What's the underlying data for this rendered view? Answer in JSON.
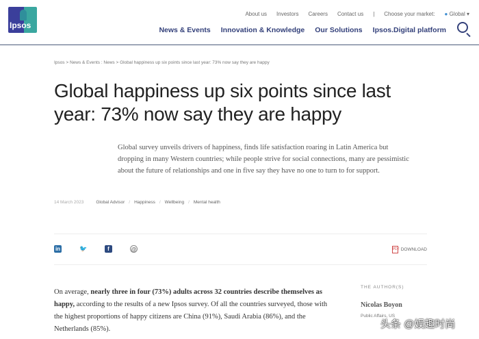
{
  "header": {
    "logo_text": "Ipsos",
    "utility": [
      "About us",
      "Investors",
      "Careers",
      "Contact us",
      "|",
      "Choose your market:"
    ],
    "market": "Global ▾",
    "nav": [
      "News & Events",
      "Innovation & Knowledge",
      "Our Solutions",
      "Ipsos.Digital platform"
    ]
  },
  "breadcrumb": "Ipsos  > News & Events : News  > Global happiness up six points since last year: 73% now say they are happy",
  "title": "Global happiness up six points since last year: 73% now say they are happy",
  "lede": "Global survey unveils drivers of happiness, finds life satisfaction roaring in Latin America but dropping in many Western countries; while people strive for social connections, many are pessimistic about the future of relationships and one in five say they have no one to turn to for support.",
  "meta": {
    "date": "14 March 2023",
    "tags": [
      "Global Advisor",
      "Happiness",
      "Wellbeing",
      "Mental health"
    ]
  },
  "share": {
    "linkedin": "in",
    "twitter": "🐦",
    "facebook": "f",
    "email": "@",
    "download": "DOWNLOAD"
  },
  "body": {
    "p1_a": "On average, ",
    "p1_b": "nearly three in four (73%) adults across 32 countries describe themselves as happy,",
    "p1_c": " according to the results of a new Ipsos survey. Of all the countries surveyed, those with the highest proportions of happy citizens are China (91%), Saudi Arabia (86%), and the Netherlands (85%)."
  },
  "author": {
    "heading": "THE AUTHOR(S)",
    "name": "Nicolas Boyon",
    "role": "Public Affairs, US"
  },
  "watermark": "头条 @娱趣时尚"
}
